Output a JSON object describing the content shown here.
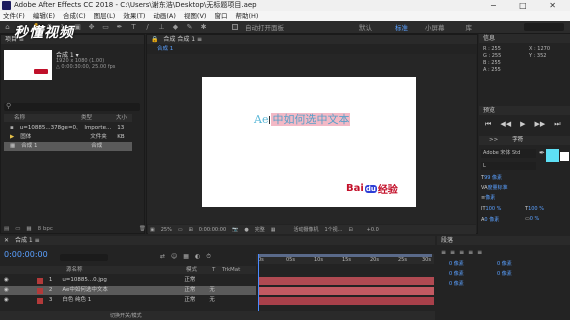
{
  "window": {
    "title": "Adobe After Effects CC 2018 - C:\\Users\\谢东浩\\Desktop\\无标题项目.aep",
    "controls": "− □ ✕"
  },
  "menu": [
    "文件(F)",
    "编辑(E)",
    "合成(C)",
    "图层(L)",
    "效果(T)",
    "动画(A)",
    "视图(V)",
    "窗口",
    "帮助(H)"
  ],
  "toolbar": {
    "auto_open": "自动打开面板",
    "ws_default": "默认",
    "ws_standard": "标准",
    "ws_small": "小屏幕",
    "ws_library": "库"
  },
  "watermark": "秒懂视频",
  "project": {
    "tab": "项目 ≡",
    "comp_name": "合成 1 ▾",
    "comp_info1": "1920 x 1080 (1.00)",
    "comp_info2": "△ 0:00:30:00, 25.00 fps",
    "col_name": "名称",
    "col_type": "类型",
    "col_size": "大小",
    "items": [
      {
        "name": "u=10885...378ge=0.jpg",
        "type": "Importe...",
        "size": "13 KB"
      },
      {
        "name": "固体",
        "type": "文件夹",
        "size": ""
      },
      {
        "name": "合成 1",
        "type": "合成",
        "size": ""
      }
    ],
    "bpc": "8 bpc"
  },
  "viewer": {
    "tab": "合成 合成 1 ≡",
    "subtab": "合成 1",
    "canvas_text_a": "Ae",
    "canvas_text": "中如何选中文本",
    "logo_text_a": "Bai",
    "logo_text_b": "du",
    "logo_text_c": "经验",
    "zoom": "25%",
    "timecode": "0:00:00:00",
    "quality": "完整",
    "camera": "活动摄像机",
    "views": "1个视...",
    "offset": "+0.0"
  },
  "info": {
    "tab": "信息",
    "r": "R : 255",
    "g": "G : 255",
    "b": "B : 255",
    "a": "A : 255",
    "x": "X : 1270",
    "y": "Y : 352"
  },
  "preview": {
    "tab": "预览"
  },
  "character": {
    "tab": "字符",
    "para_tab": "段落",
    "font": "Adobe 宋体 Std",
    "style": "L",
    "size": "99 像素",
    "tracking": "度量标准",
    "kern": "0",
    "stroke": "像素",
    "scale_v": "100 %",
    "baseline": "0 像素",
    "scale_h": "100 %",
    "tsume": "0 %",
    "fill_color": "#5ee0f5"
  },
  "timeline": {
    "tab": "合成 1 ≡",
    "timecode": "0:00:00:00",
    "cols": {
      "name": "源名称",
      "mode": "模式",
      "t": "T",
      "trkmat": "TrkMat",
      "parent": "父级"
    },
    "ruler_ticks": [
      "0s",
      "05s",
      "10s",
      "15s",
      "20s",
      "25s",
      "30s"
    ],
    "layers": [
      {
        "num": "1",
        "name": "u=10885...0.jpg",
        "mode": "正常",
        "trkmat": "",
        "parent": "无"
      },
      {
        "num": "2",
        "name": "Ae中如何选中文本",
        "mode": "正常",
        "trkmat": "无",
        "parent": "无"
      },
      {
        "num": "3",
        "name": "白色 纯色 1",
        "mode": "正常",
        "trkmat": "无",
        "parent": "无"
      }
    ],
    "toggle_label": "切换开关/模式"
  },
  "paragraph": {
    "tab": "段落",
    "vals": [
      "0 像素",
      "0 像素",
      "0 像素",
      "0 像素",
      "0 像素"
    ]
  }
}
